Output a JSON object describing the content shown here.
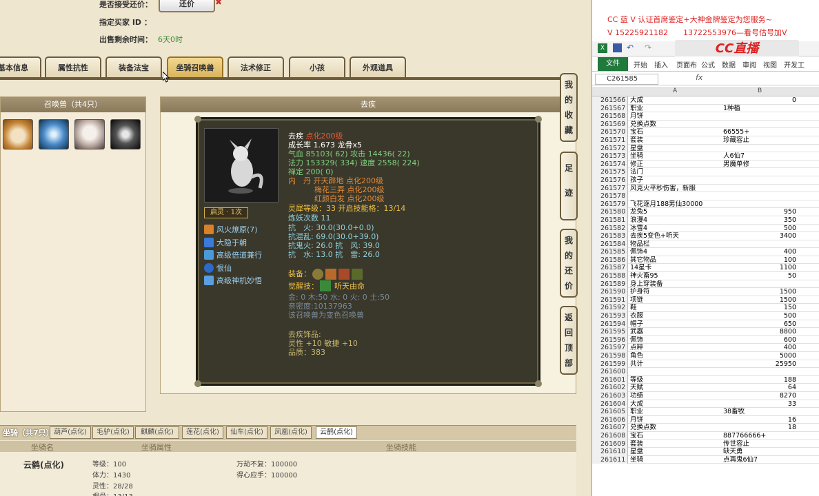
{
  "top": {
    "direct_counter_label": "是否接受还价：",
    "counter_button": "还价",
    "buyer_id_label": "指定买家 ID ：",
    "time_left_label": "出售剩余时间：",
    "time_left_value": "6天0时"
  },
  "tabs": [
    "基本信息",
    "属性抗性",
    "装备法宝",
    "坐骑召唤兽",
    "法术修正",
    "小孩",
    "外观道具"
  ],
  "summon_panel": {
    "title": "召唤兽（共4只）"
  },
  "detail_panel": {
    "title": "去疾"
  },
  "pet": {
    "name": "去疾",
    "name_suffix": "点化200级",
    "growth": "成长率 1.673  龙骨x5",
    "hp": "气血 85103( 62)",
    "attack": "攻击 14436( 22)",
    "mana": "法力 153329( 334)",
    "speed": "速度 2558( 224)",
    "defense": "禅定 200( 0)",
    "neidan1": "内　丹  开天辟地 点化200级",
    "neidan2": "梅花三弄 点化200级",
    "neidan3": "红颜白发 点化200级",
    "spirit_level": "灵犀等级：33  开启技能格：13/14",
    "refine": "炼妖次数 11",
    "resist_fire": "抗　火: 30.0(30.0+0.0)",
    "resist_chaos": "抗混乱: 69.0(30.0+39.0)",
    "resist_ghost": "抗鬼火: 26.0 抗　风: 39.0",
    "resist_water": "抗　水: 13.0 抗　雷: 26.0",
    "equip_label": "装备：",
    "awaken_label": "觉醒技：",
    "awaken_skill": "听天由命",
    "five_elements": "金: 0 木:50 水: 0 火: 0 土:50",
    "intimacy": "亲密度:10137963",
    "variant": "该召唤兽为变色召唤兽",
    "ornament_title": "去疾饰品:",
    "ornament_stats": "灵性 +10 敏捷 +10",
    "ornament_quality": "品质：383",
    "awaken_badge": "启灵 · 1次"
  },
  "skills": [
    "风火燎原(7)",
    "大隐于朝",
    "高级倍道兼行",
    "恨仙",
    "高级神机妙悟"
  ],
  "side_buttons": [
    "我的收藏",
    "足迹",
    "我的还价",
    "返回顶部"
  ],
  "mount": {
    "header": "坐骑（共7只）",
    "tabs": [
      "葫芦(点化)",
      "毛驴(点化)",
      "麒麟(点化)",
      "莲花(点化)",
      "仙车(点化)",
      "凤凰(点化)",
      "云鹤(点化)"
    ],
    "col_name": "坐骑名",
    "col_attr": "坐骑属性",
    "col_skill": "坐骑技能",
    "name": "云鹤(点化)",
    "attrs": [
      "等级：100",
      "体力：1430",
      "灵性：28/28",
      "根骨：13/13"
    ],
    "skills": [
      "万劫不复：100000",
      "得心应手：100000"
    ]
  },
  "excel": {
    "ad_line1": "CC 蓝 V 认证首席鉴定+大神金牌鉴定为您服务~",
    "ad_line2": "V 15225921182　　13722553976—看号估号加V",
    "cc_logo": "CC直播",
    "ribbon_tabs": [
      "文件",
      "开始",
      "插入",
      "页面布",
      "公式",
      "数据",
      "审阅",
      "视图",
      "开发工"
    ],
    "name_box": "C261585",
    "fx": "fx",
    "col_a": "A",
    "col_b": "B",
    "rows": [
      [
        "261566",
        "大成",
        "0"
      ],
      [
        "261567",
        "职业",
        "1种植"
      ],
      [
        "261568",
        "月饼",
        ""
      ],
      [
        "261569",
        "兑换点数",
        ""
      ],
      [
        "261570",
        "宝石",
        "66555+"
      ],
      [
        "261571",
        "套装",
        "珍藏容止"
      ],
      [
        "261572",
        "星盘",
        ""
      ],
      [
        "261573",
        "坐骑",
        "人6仙7"
      ],
      [
        "261574",
        "修正",
        "男魔单修"
      ],
      [
        "261575",
        "法门",
        ""
      ],
      [
        "261576",
        "孩子",
        ""
      ],
      [
        "261577",
        "风克火平秒伤害，新服",
        ""
      ],
      [
        "261578",
        "",
        ""
      ],
      [
        "261579",
        "飞花逐月188男仙30000",
        ""
      ],
      [
        "261580",
        "龙兔5",
        "950"
      ],
      [
        "261581",
        "浪漫4",
        "350"
      ],
      [
        "261582",
        "冰雪4",
        "500"
      ],
      [
        "261583",
        "去疾5变色+听天",
        "3400"
      ],
      [
        "261584",
        "物品栏",
        ""
      ],
      [
        "261585",
        "佩饰4",
        "400"
      ],
      [
        "261586",
        "其它物品",
        "100"
      ],
      [
        "261587",
        "14星卡",
        "1100"
      ],
      [
        "261588",
        "神火畜95",
        "50"
      ],
      [
        "261589",
        "身上穿装备",
        ""
      ],
      [
        "261590",
        "护身符",
        "1500"
      ],
      [
        "261591",
        "项链",
        "1500"
      ],
      [
        "261592",
        "鞋",
        "150"
      ],
      [
        "261593",
        "衣服",
        "500"
      ],
      [
        "261594",
        "帽子",
        "650"
      ],
      [
        "261595",
        "武器",
        "8800"
      ],
      [
        "261596",
        "佩饰",
        "600"
      ],
      [
        "261597",
        "点粹",
        "400"
      ],
      [
        "261598",
        "角色",
        "5000"
      ],
      [
        "261599",
        "共计",
        "25950"
      ],
      [
        "261600",
        "",
        ""
      ],
      [
        "261601",
        "等级",
        "188"
      ],
      [
        "261602",
        "天赋",
        "64"
      ],
      [
        "261603",
        "功绩",
        "8270"
      ],
      [
        "261604",
        "大成",
        "33"
      ],
      [
        "261605",
        "职业",
        "38畜牧"
      ],
      [
        "261606",
        "月饼",
        "16"
      ],
      [
        "261607",
        "兑换点数",
        "18"
      ],
      [
        "261608",
        "宝石",
        "887766666+"
      ],
      [
        "261609",
        "套装",
        "传世容止"
      ],
      [
        "261610",
        "星盘",
        "缺天勇"
      ],
      [
        "261611",
        "坐骑",
        "点再鬼6仙7"
      ]
    ]
  },
  "colors": {
    "gold": "#e8c870",
    "green": "#7fd07f",
    "cyan": "#8fd4e0",
    "orange": "#e08a3a",
    "excel_green": "#1f7a3c"
  }
}
